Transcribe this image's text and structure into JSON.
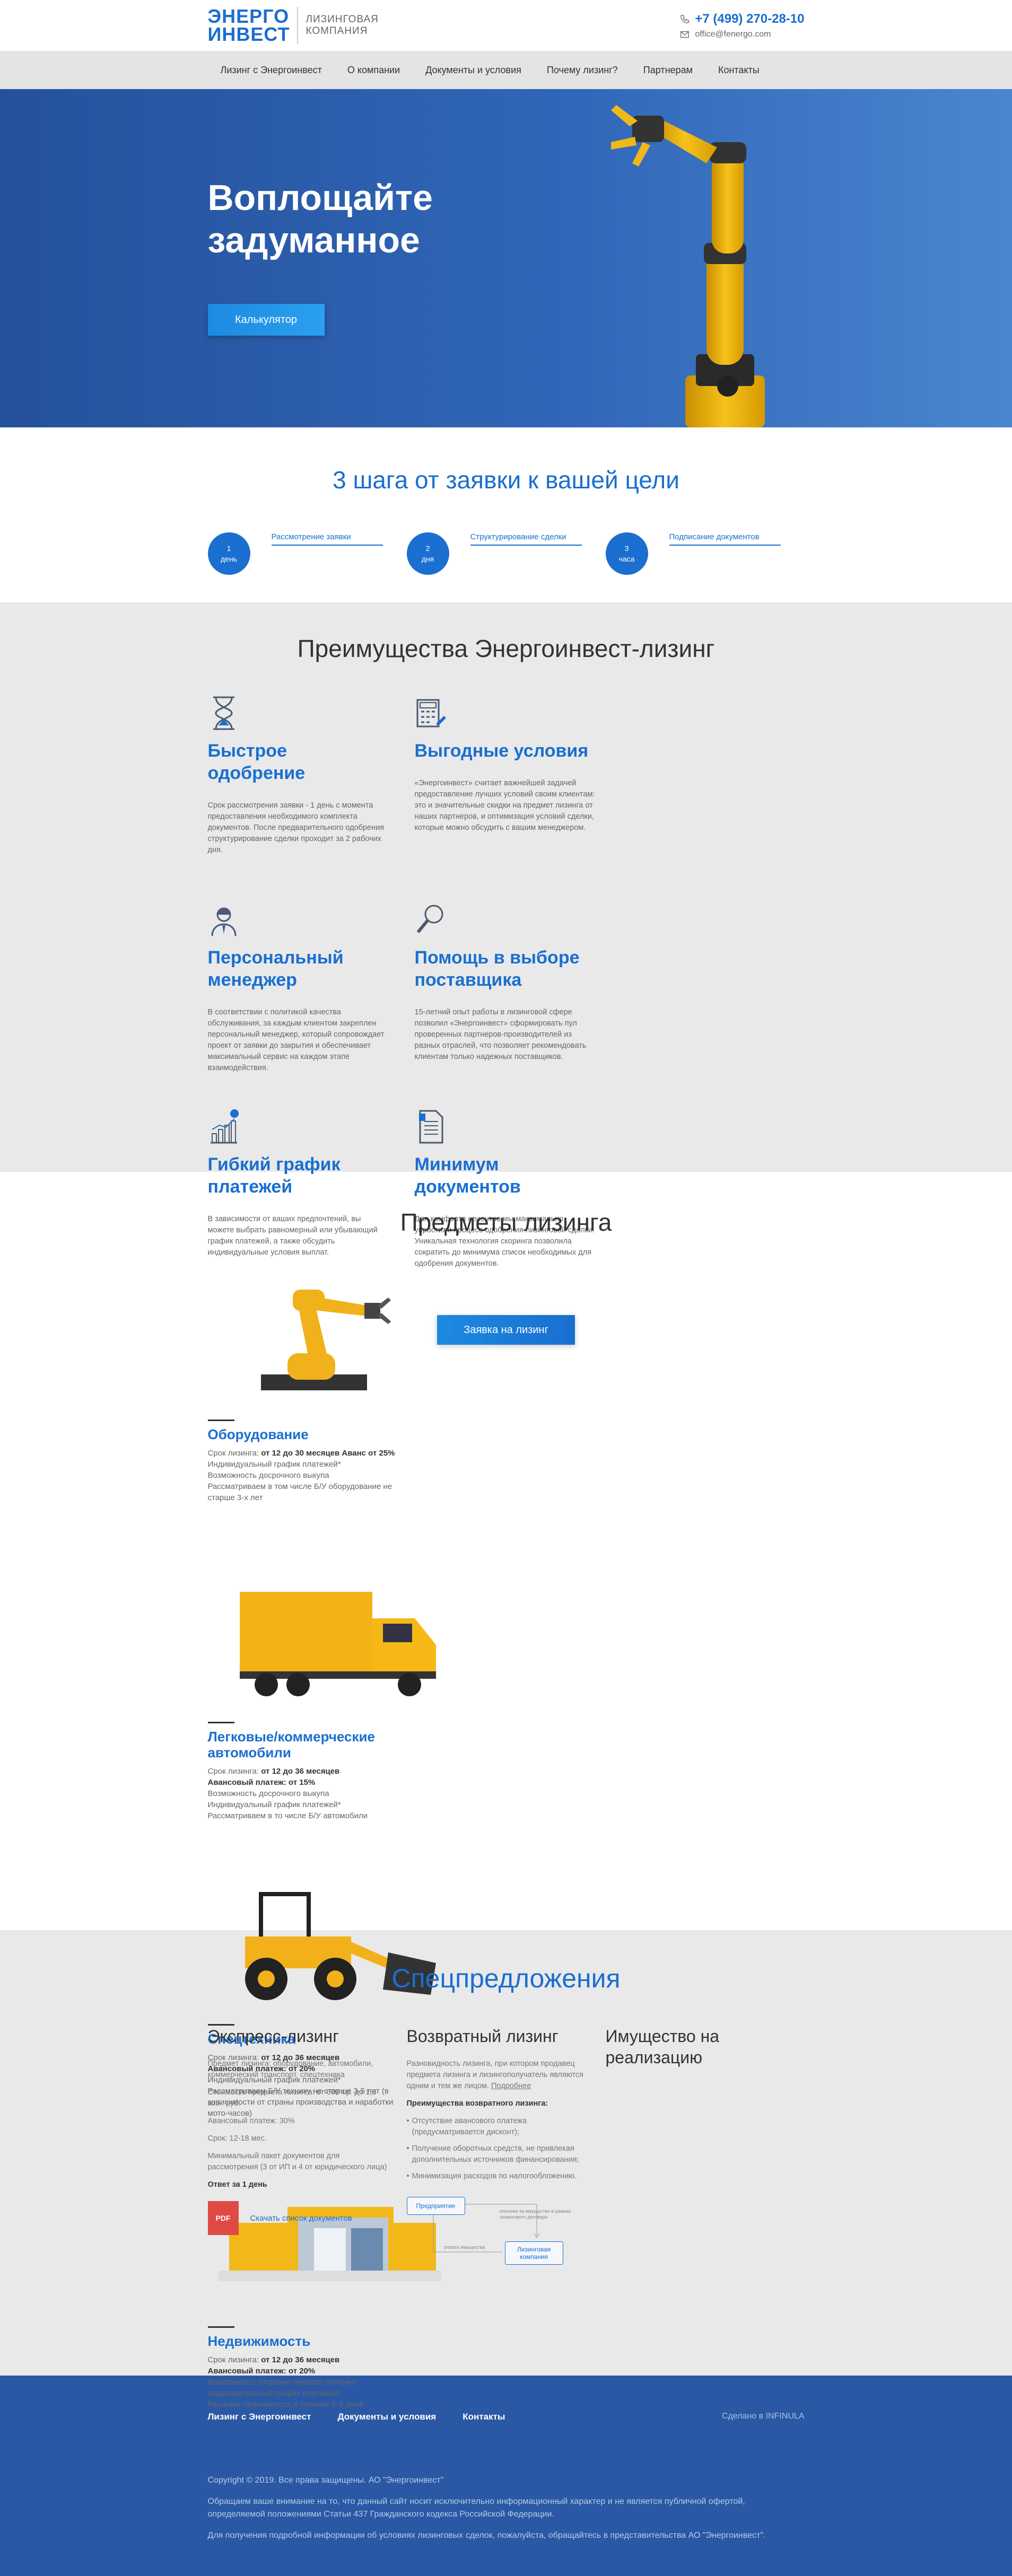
{
  "header": {
    "logo_line1": "ЭНЕРГО",
    "logo_line2": "ИНВЕСТ",
    "logo_sub1": "ЛИЗИНГОВАЯ",
    "logo_sub2": "КОМПАНИЯ",
    "phone": "+7 (499) 270-28-10",
    "email": "office@fenergo.com"
  },
  "nav": [
    "Лизинг с Энергоинвест",
    "О компании",
    "Документы и условия",
    "Почему лизинг?",
    "Партнерам",
    "Контакты"
  ],
  "hero": {
    "title": "Воплощайте задуманное",
    "button": "Калькулятор"
  },
  "steps": {
    "title": "3 шага от заявки к вашей цели",
    "items": [
      {
        "num": "1",
        "unit": "день",
        "label": "Рассмотрение заявки"
      },
      {
        "num": "2",
        "unit": "дня",
        "label": "Структурирование сделки"
      },
      {
        "num": "3",
        "unit": "часа",
        "label": "Подписание документов"
      }
    ]
  },
  "advantages": {
    "title": "Преимущества Энергоинвест-лизинг",
    "items": [
      {
        "icon": "hourglass-icon",
        "title": "Быстрое одобрение",
        "text": "Срок рассмотрения заявки - 1 день с момента предоставления необходимого комплекта документов. После предварительного одобрения структурирование сделки проходит за 2 рабочих дня."
      },
      {
        "icon": "calculator-icon",
        "title": "Выгодные условия",
        "text": "«Энергоинвест» считает важнейшей задачей предоставление лучших условий своим клиентам: это и значительные скидки на предмет лизинга от наших партнеров, и оптимизация условий сделки, которые можно обсудить с вашим менеджером."
      },
      {
        "icon": "manager-icon",
        "title": "Персональный менеджер",
        "text": "В соответствии с политикой качества обслуживания, за каждым клиентом закреплен персональный менеджер, который сопровождает проект от заявки до закрытия и обеспечивает максимальный сервис на каждом этапе взаимодействия."
      },
      {
        "icon": "magnifier-icon",
        "title": "Помощь в выборе поставщика",
        "text": "15-летний опыт работы в лизинговой сфере позволил «Энергоинвест» сформировать пул проверенных партнеров-производителей из разных отраслей, что позволяет рекомендовать клиентам только надежных поставщиков."
      },
      {
        "icon": "chart-icon",
        "title": "Гибкий график платежей",
        "text": "В зависимости от ваших предпочтений, вы можете выбрать равномерный или убывающий график платежей, а также обсудить индивидуальные условия выплат."
      },
      {
        "icon": "document-icon",
        "title": "Минимум документов",
        "text": "Для комфорта клиентов мы максимально упростили процесс одобрения лизинговой сделки. Уникальная технология скоринга позволила сократить до минимума список необходимых для одобрения документов."
      }
    ],
    "button": "Заявка на лизинг"
  },
  "lease": {
    "title": "Предметы лизинга",
    "items": [
      {
        "title": "Оборудование",
        "lines": [
          {
            "pre": "Срок лизинга: ",
            "bold": "от 12 до 30 месяцев Аванс от 25%"
          },
          {
            "pre": "Индивидуальный график платежей*",
            "bold": ""
          },
          {
            "pre": "Возможность досрочного выкупа",
            "bold": ""
          },
          {
            "pre": "Рассматриваем в том числе Б/У оборудование не старше 3-х лет",
            "bold": ""
          }
        ]
      },
      {
        "title": "Легковые/коммерческие автомобили",
        "lines": [
          {
            "pre": "Срок лизинга: ",
            "bold": "от 12 до 36 месяцев"
          },
          {
            "pre": "",
            "bold": "Авансовый платеж: от 15%"
          },
          {
            "pre": "Возможность досрочного выкупа",
            "bold": ""
          },
          {
            "pre": "Индивидуальный график платежей*",
            "bold": ""
          },
          {
            "pre": "Рассматриваем в то числе Б/У автомобили",
            "bold": ""
          }
        ]
      },
      {
        "title": "Спецтехника",
        "lines": [
          {
            "pre": "Срок лизинга: ",
            "bold": "от 12 до 36 месяцев"
          },
          {
            "pre": "",
            "bold": "Авансовый платеж: от 20%"
          },
          {
            "pre": "Индивидуальный график платежей*",
            "bold": ""
          },
          {
            "pre": "Рассматриваем Б/У технику не старше 3-5 лет (в зависимости от страны производства и наработки мото-часов)",
            "bold": ""
          }
        ]
      },
      {
        "title": "Недвижимость",
        "lines": [
          {
            "pre": "Срок лизинга: ",
            "bold": "от 12 до 36 месяцев"
          },
          {
            "pre": "",
            "bold": "Авансовый платеж: от 20%"
          },
          {
            "pre": "Возможность отсрочки первого платежа",
            "bold": ""
          },
          {
            "pre": "Индивидуальный график платежей*",
            "bold": ""
          },
          {
            "pre": "Решение принимается в течение 2-3 дней",
            "bold": ""
          }
        ]
      }
    ]
  },
  "special": {
    "title": "Спецпредложения",
    "express": {
      "title": "Экспресс-лизинг",
      "p1": "Предмет лизинга: оборудование, автомобили, коммерческий транспорт, спецтехника",
      "p2": "Стоимость предмета лизинга: от 600 т.р. до 1,5 млн. руб.",
      "p3": "Авансовый платеж: 30%",
      "p4": "Срок: 12-18 мес.",
      "p5": "Минимальный пакет документов для рассмотрения (3 от ИП и 4 от юридического лица)",
      "p6": "Ответ за 1 день",
      "pdf_label": "PDF",
      "pdf_link": "Скачать список документов"
    },
    "reverse": {
      "title": "Возвратный лизинг",
      "intro": "Разновидность лизинга, при котором продавец предмета лизинга и лизингополучатель являются одним и тем же лицом.",
      "more": "Подробнее",
      "adv_title": "Преимущества возвратного лизинга:",
      "list": [
        "Отсутствие авансового платежа (предусматривается дисконт);",
        "Получение оборотных средств, не привлекая дополнительных источников финансирования;",
        "Минимизация расходов по налогообложению."
      ],
      "d_box1": "Предприятие",
      "d_box2": "Лизинговая компания",
      "d_arrow1": "платежи за имущество в рамках лизингового договора",
      "d_arrow2": "оплата имущества"
    },
    "realization": {
      "title": "Имущество на реализацию"
    }
  },
  "footer": {
    "links": [
      "Лизинг с Энергоинвест",
      "Документы и условия",
      "Контакты"
    ],
    "made": "Сделано в INFINULA",
    "copy": "Copyright © 2019. Все права защищены. АО \"Энергоинвест\"",
    "note1": "Обращаем ваше внимание на то, что данный сайт носит исключительно информационный характер и не является публичной офертой, определяемой положениями Статьи 437 Гражданского кодекса Российской Федерации.",
    "note2": "Для получения подробной информации об условиях лизинговых сделок, пожалуйста, обращайтесь в представительства АО \"Энергоинвест\"."
  }
}
